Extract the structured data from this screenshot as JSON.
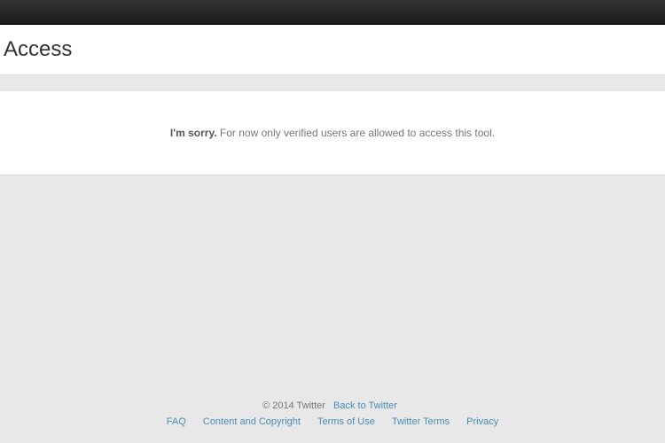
{
  "header": {
    "title": "Access"
  },
  "message": {
    "prefix": "I'm sorry.",
    "body": "For now only verified users are allowed to access this tool."
  },
  "footer": {
    "copyright": "© 2014 Twitter",
    "back_link": "Back to Twitter",
    "links": [
      "FAQ",
      "Content and Copyright",
      "Terms of Use",
      "Twitter Terms",
      "Privacy"
    ]
  }
}
